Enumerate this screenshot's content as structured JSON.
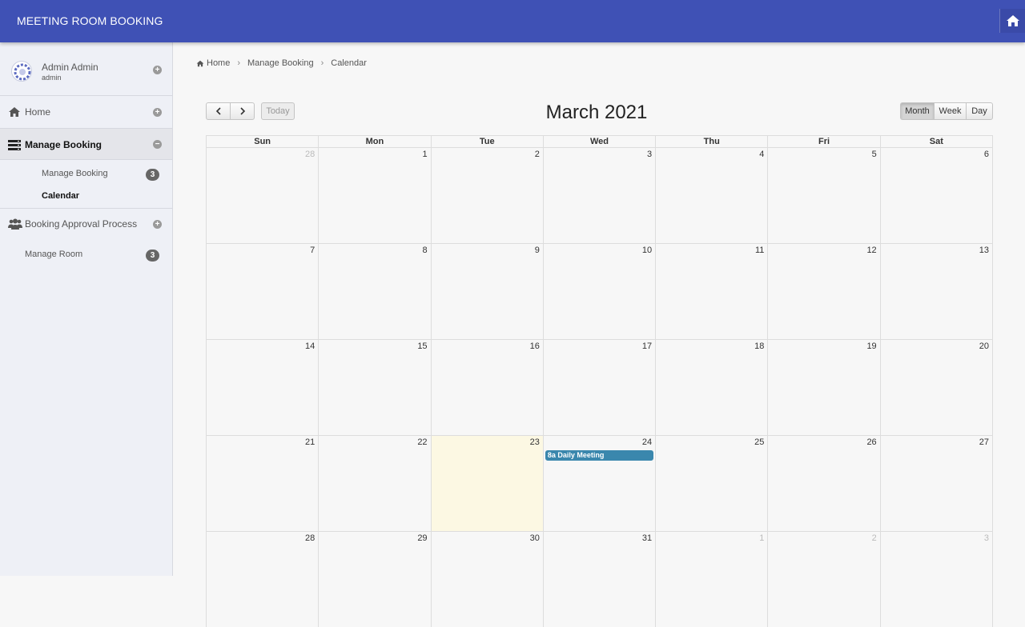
{
  "app": {
    "title": "MEETING ROOM BOOKING"
  },
  "user": {
    "name": "Admin Admin",
    "role": "admin"
  },
  "sidebar": {
    "home": "Home",
    "manage_booking": "Manage Booking",
    "sub_manage_booking": "Manage Booking",
    "sub_manage_booking_count": "3",
    "sub_calendar": "Calendar",
    "booking_approval": "Booking Approval Process",
    "manage_room": "Manage Room",
    "manage_room_count": "3"
  },
  "breadcrumb": [
    "Home",
    "Manage Booking",
    "Calendar"
  ],
  "calendar": {
    "title": "March 2021",
    "today_label": "Today",
    "views": [
      "Month",
      "Week",
      "Day"
    ],
    "active_view": "Month",
    "weekdays": [
      "Sun",
      "Mon",
      "Tue",
      "Wed",
      "Thu",
      "Fri",
      "Sat"
    ],
    "weeks": [
      [
        {
          "d": "28",
          "other": true
        },
        {
          "d": "1"
        },
        {
          "d": "2"
        },
        {
          "d": "3"
        },
        {
          "d": "4"
        },
        {
          "d": "5"
        },
        {
          "d": "6"
        }
      ],
      [
        {
          "d": "7"
        },
        {
          "d": "8"
        },
        {
          "d": "9"
        },
        {
          "d": "10"
        },
        {
          "d": "11"
        },
        {
          "d": "12"
        },
        {
          "d": "13"
        }
      ],
      [
        {
          "d": "14"
        },
        {
          "d": "15"
        },
        {
          "d": "16"
        },
        {
          "d": "17"
        },
        {
          "d": "18"
        },
        {
          "d": "19"
        },
        {
          "d": "20"
        }
      ],
      [
        {
          "d": "21"
        },
        {
          "d": "22"
        },
        {
          "d": "23",
          "today": true
        },
        {
          "d": "24",
          "event": "8a Daily Meeting"
        },
        {
          "d": "25"
        },
        {
          "d": "26"
        },
        {
          "d": "27"
        }
      ],
      [
        {
          "d": "28"
        },
        {
          "d": "29"
        },
        {
          "d": "30"
        },
        {
          "d": "31"
        },
        {
          "d": "1",
          "other": true
        },
        {
          "d": "2",
          "other": true
        },
        {
          "d": "3",
          "other": true
        }
      ]
    ],
    "colors": {
      "event": "#3a87ad",
      "today": "#fcf8e3",
      "header": "#3f51b5"
    }
  }
}
